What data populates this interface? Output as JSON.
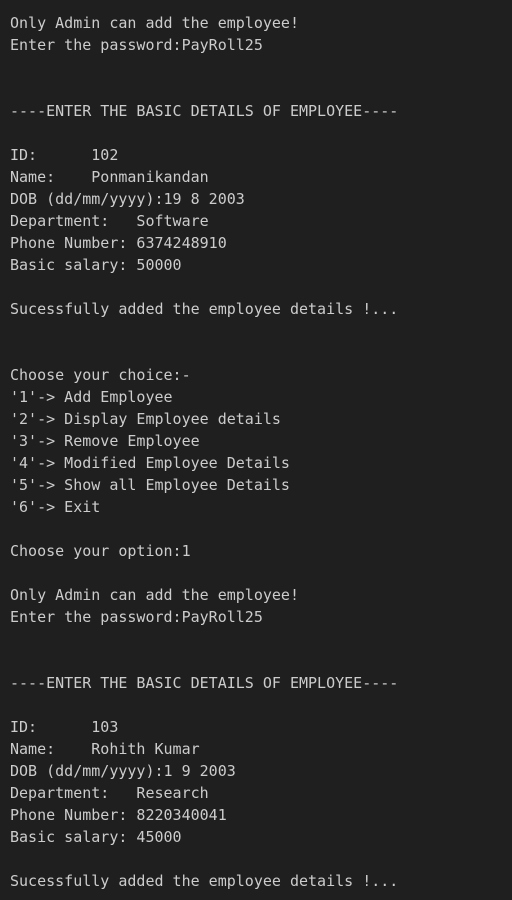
{
  "terminal": {
    "background": "#1f1f1f",
    "foreground": "#cccccc",
    "lines": [
      "Only Admin can add the employee!",
      "Enter the password:PayRoll25",
      "",
      "",
      "----ENTER THE BASIC DETAILS OF EMPLOYEE----",
      "",
      "ID:      102",
      "Name:    Ponmanikandan",
      "DOB (dd/mm/yyyy):19 8 2003",
      "Department:   Software",
      "Phone Number: 6374248910",
      "Basic salary: 50000",
      "",
      "Sucessfully added the employee details !...",
      "",
      "",
      "Choose your choice:-",
      "'1'-> Add Employee",
      "'2'-> Display Employee details",
      "'3'-> Remove Employee",
      "'4'-> Modified Employee Details",
      "'5'-> Show all Employee Details",
      "'6'-> Exit",
      "",
      "Choose your option:1",
      "",
      "Only Admin can add the employee!",
      "Enter the password:PayRoll25",
      "",
      "",
      "----ENTER THE BASIC DETAILS OF EMPLOYEE----",
      "",
      "ID:      103",
      "Name:    Rohith Kumar",
      "DOB (dd/mm/yyyy):1 9 2003",
      "Department:   Research",
      "Phone Number: 8220340041",
      "Basic salary: 45000",
      "",
      "Sucessfully added the employee details !..."
    ]
  }
}
